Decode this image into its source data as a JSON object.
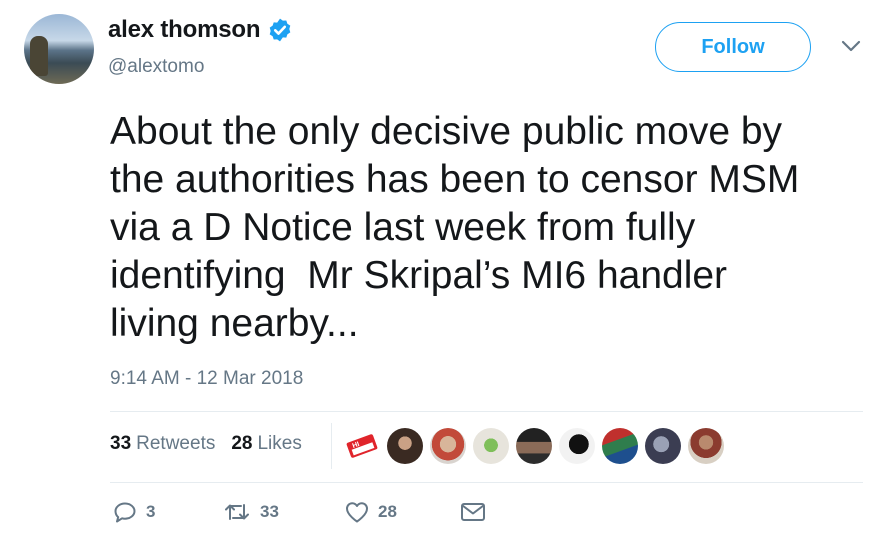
{
  "author": {
    "display_name": "alex thomson",
    "handle": "@alextomo",
    "verified": true
  },
  "follow_button": {
    "label": "Follow"
  },
  "tweet": {
    "text": "About the only decisive public move by\nthe authorities has been to censor MSM\nvia a D Notice last week from fully\nidentifying  Mr Skripal’s MI6 handler\nliving nearby...",
    "timestamp": "9:14 AM - 12 Mar 2018"
  },
  "stats": {
    "retweets": {
      "count": "33",
      "label": "Retweets"
    },
    "likes": {
      "count": "28",
      "label": "Likes"
    }
  },
  "likers": [
    {
      "badge": "HI"
    },
    {},
    {},
    {},
    {},
    {},
    {},
    {},
    {}
  ],
  "actions": {
    "reply_count": "3",
    "retweet_count": "33",
    "like_count": "28"
  },
  "colors": {
    "accent": "#1da1f2",
    "secondary_text": "#657786",
    "divider": "#e6ecf0"
  }
}
